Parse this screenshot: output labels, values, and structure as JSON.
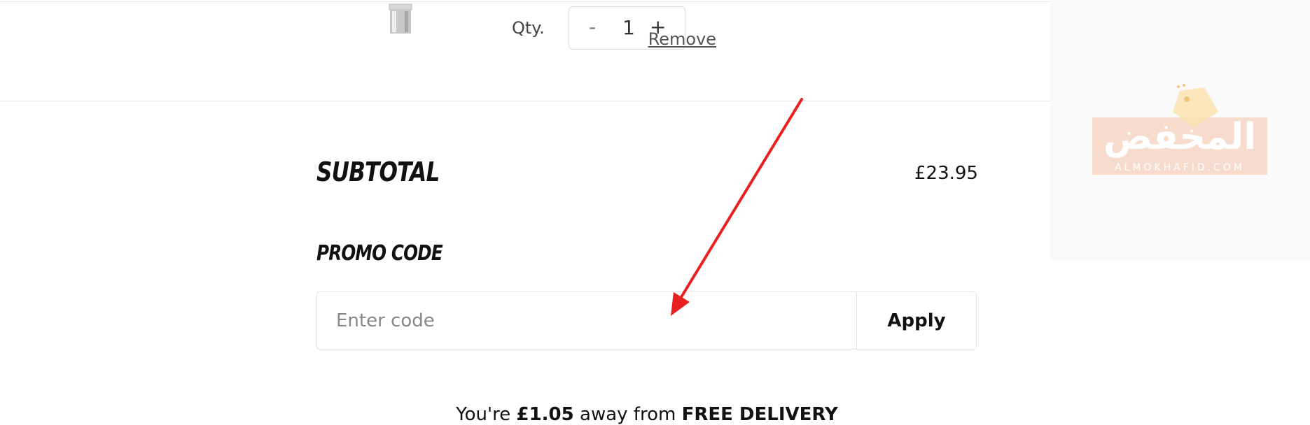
{
  "cart_item": {
    "qty_label": "Qty.",
    "qty_value": "1",
    "minus_label": "-",
    "plus_label": "+",
    "remove_label": "Remove"
  },
  "summary": {
    "subtotal_label": "SUBTOTAL",
    "subtotal_value": "£23.95",
    "promo_label": "PROMO CODE",
    "promo_placeholder": "Enter code",
    "apply_label": "Apply"
  },
  "delivery": {
    "prefix": "You're ",
    "amount": "£1.05",
    "middle": " away from ",
    "target": "FREE DELIVERY"
  },
  "watermark": {
    "arabic": "المخفض",
    "latin": "ALMOKHAFID.COM"
  },
  "colors": {
    "arrow": "#e82020",
    "watermark": "#f6d8c8"
  }
}
